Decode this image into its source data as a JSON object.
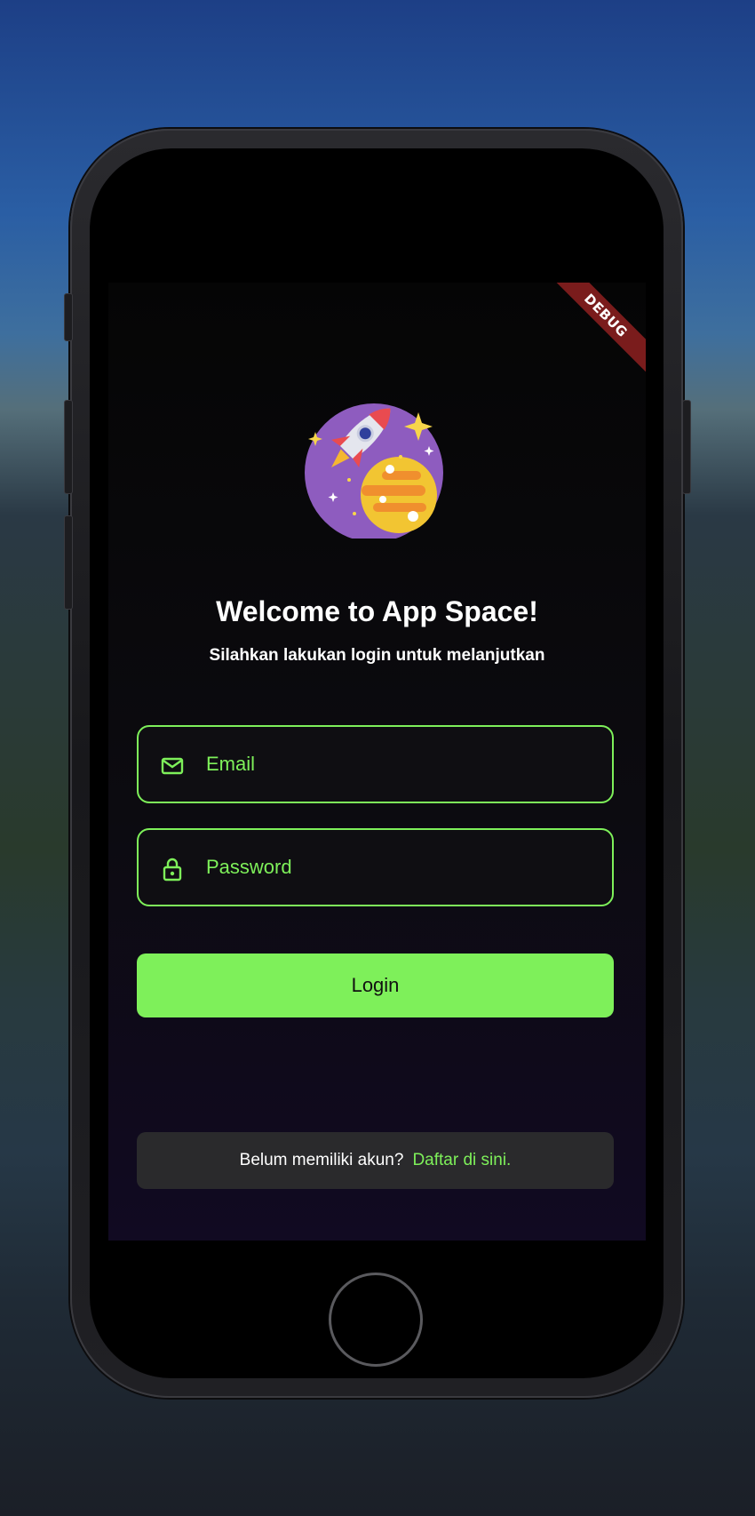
{
  "debug_banner": "DEBUG",
  "welcome": {
    "title": "Welcome to App Space!",
    "subtitle": "Silahkan lakukan login untuk melanjutkan"
  },
  "form": {
    "email": {
      "placeholder": "Email",
      "value": "",
      "icon": "mail-icon"
    },
    "password": {
      "placeholder": "Password",
      "value": "",
      "icon": "lock-icon"
    },
    "login_label": "Login"
  },
  "register": {
    "question": "Belum memiliki akun?",
    "link": "Daftar di sini."
  },
  "colors": {
    "accent": "#7ef05a",
    "screen_bg": "#0c0b10",
    "register_bg": "#2a2a2c",
    "debug_ribbon": "#7a1c1c"
  }
}
